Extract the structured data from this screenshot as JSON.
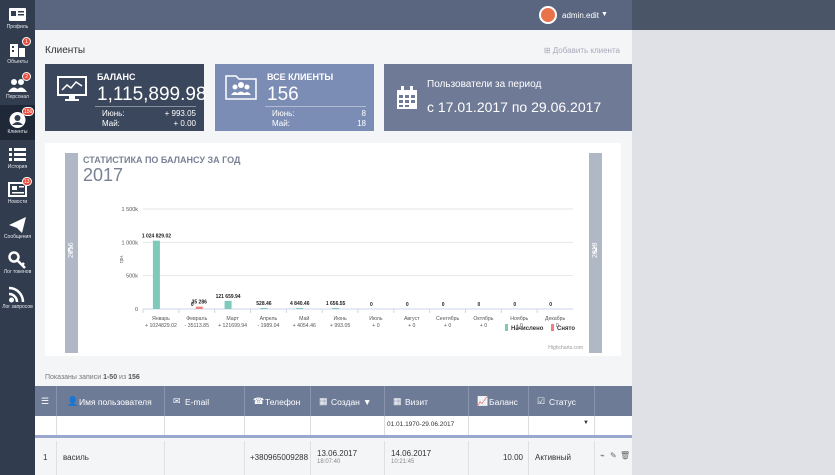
{
  "sidebar": {
    "items": [
      {
        "label": "Профиль",
        "icon": "profile-icon",
        "badge": ""
      },
      {
        "label": "Объекты",
        "icon": "buildings-icon",
        "badge": "1"
      },
      {
        "label": "Персонал",
        "icon": "users-icon",
        "badge": "2"
      },
      {
        "label": "Клиенты",
        "icon": "clients-icon",
        "badge": "156",
        "active": true
      },
      {
        "label": "История",
        "icon": "list-icon",
        "badge": ""
      },
      {
        "label": "Новости",
        "icon": "news-icon",
        "badge": "13"
      },
      {
        "label": "Сообщения",
        "icon": "paper-plane-icon",
        "badge": ""
      },
      {
        "label": "Лог токенов",
        "icon": "key-icon",
        "badge": ""
      },
      {
        "label": "Лог запросов",
        "icon": "rss-icon",
        "badge": ""
      }
    ]
  },
  "header": {
    "user_name": "admin.edit"
  },
  "page": {
    "title": "Клиенты",
    "add_client": "Добавить клиента"
  },
  "cards": {
    "balance": {
      "title": "БАЛАНС",
      "value": "1,115,899.98",
      "row1_label": "Июнь:",
      "row1_value": "+ 993.05",
      "row2_label": "Май:",
      "row2_value": "+ 0.00"
    },
    "clients": {
      "title": "ВСЕ КЛИЕНТЫ",
      "value": "156",
      "row1_label": "Июнь:",
      "row1_value": "8",
      "row2_label": "Май:",
      "row2_value": "18"
    },
    "period": {
      "title": "Пользователи за период",
      "dates": "с 17.01.2017 по 29.06.2017"
    }
  },
  "chart": {
    "prev_year": "2016",
    "next_year": "2018",
    "credit": "Highcharts.com"
  },
  "chart_data": {
    "type": "bar",
    "title": "СТАТИСТИКА ПО БАЛАНСУ ЗА ГОД",
    "subtitle": "2017",
    "ylabel": "грн.",
    "ylim": [
      0,
      1500000
    ],
    "yticks": [
      "0",
      "500k",
      "1 000k",
      "1 500k"
    ],
    "categories": [
      "Январь",
      "Февраль",
      "Март",
      "Апрель",
      "Май",
      "Июнь",
      "Июль",
      "Август",
      "Сентябрь",
      "Октябрь",
      "Ноябрь",
      "Декабрь"
    ],
    "category_sums": [
      "+ 1024829.02",
      "- 35113.85",
      "+ 121699.94",
      "- 1989.04",
      "+ 4054.46",
      "+ 993.05",
      "+ 0",
      "+ 0",
      "+ 0",
      "+ 0",
      "+ 0",
      "+ 0"
    ],
    "series": [
      {
        "name": "Начислено",
        "color": "#7ec9b8",
        "values": [
          1024829.02,
          0,
          121659.94,
          528.46,
          4840.46,
          1656.55,
          0,
          0,
          0,
          0,
          0,
          0
        ],
        "labels": [
          "1 024 829.02",
          "0",
          "121 659.94",
          "528.46",
          "4 840.46",
          "1 656.55",
          "0",
          "0",
          "0",
          "0",
          "0",
          "0"
        ]
      },
      {
        "name": "Снято",
        "color": "#f08080",
        "values": [
          0,
          35286,
          0,
          0,
          0,
          0,
          0,
          0,
          0,
          0,
          0,
          0
        ],
        "labels": [
          "",
          "35 286",
          "",
          "",
          "",
          "",
          "",
          "",
          "",
          "",
          "",
          ""
        ]
      }
    ],
    "legend_position": "bottom-right"
  },
  "table": {
    "records_prefix": "Показаны записи",
    "records_range": "1-50",
    "records_mid": "из",
    "records_total": "156",
    "columns": [
      {
        "label": "Имя пользователя",
        "icon": "user-icon"
      },
      {
        "label": "E-mail",
        "icon": "envelope-icon"
      },
      {
        "label": "Телефон",
        "icon": "phone-icon"
      },
      {
        "label": "Создан",
        "icon": "calendar-icon"
      },
      {
        "label": "Визит",
        "icon": "calendar-icon"
      },
      {
        "label": "Баланс",
        "icon": "chart-icon"
      },
      {
        "label": "Статус",
        "icon": "checkbox-icon"
      }
    ],
    "filter_visit": "01.01.1970-29.06.2017",
    "rows": [
      {
        "n": "1",
        "name": "василь",
        "email": "",
        "phone": "+380965009288",
        "created": "13.06.2017",
        "created_time": "18:07:40",
        "visit": "14.06.2017",
        "visit_time": "10:21:45",
        "balance": "10.00",
        "status": "Активный"
      }
    ]
  }
}
